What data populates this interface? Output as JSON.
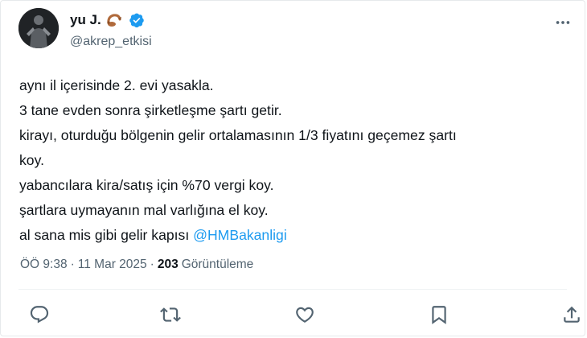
{
  "tweet": {
    "display_name": "yu J.",
    "handle": "@akrep_etkisi",
    "lines": [
      "aynı il içerisinde 2. evi yasakla.",
      "3 tane evden sonra şirketleşme şartı getir.",
      "kirayı, oturduğu bölgenin gelir ortalamasının 1/3 fiyatını geçemez şartı",
      "koy.",
      "yabancılara kira/satış için %70 vergi koy.",
      "şartlara uymayanın mal varlığına el koy."
    ],
    "last_line_prefix": "al sana mis gibi gelir kapısı ",
    "mention": "@HMBakanligi",
    "meta": {
      "time": "ÖÖ 9:38",
      "separator": "·",
      "date": "11 Mar 2025",
      "views_count": "203",
      "views_label": "Görüntüleme"
    }
  },
  "icons": {
    "emoji": "scorpion-emoji-icon",
    "verified": "verified-badge-icon",
    "more": "more-options-icon",
    "reply": "reply-icon",
    "retweet": "retweet-icon",
    "like": "like-icon",
    "bookmark": "bookmark-icon",
    "share": "share-icon"
  },
  "colors": {
    "text": "#0f1419",
    "secondary": "#536471",
    "link": "#1d9bf0",
    "verified": "#1d9bf0"
  }
}
